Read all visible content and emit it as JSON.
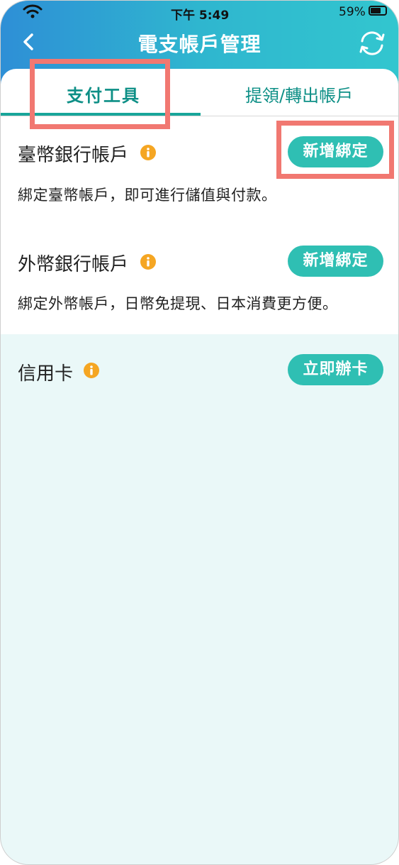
{
  "status_bar": {
    "time": "下午 5:49",
    "battery": "59%"
  },
  "header": {
    "title": "電支帳戶管理"
  },
  "tabs": [
    {
      "label": "支付工具",
      "active": true
    },
    {
      "label": "提領/轉出帳戶",
      "active": false
    }
  ],
  "sections": {
    "twd": {
      "title": "臺幣銀行帳戶",
      "button": "新增綁定",
      "description": "綁定臺幣帳戶，即可進行儲值與付款。"
    },
    "fx": {
      "title": "外幣銀行帳戶",
      "button": "新增綁定",
      "description": "綁定外幣帳戶，日幣免提現、日本消費更方便。"
    },
    "credit": {
      "title": "信用卡",
      "button": "立即辦卡"
    }
  },
  "colors": {
    "accent": "#2fbfb3",
    "info": "#f5a623",
    "highlight": "#f17871",
    "tab_text": "#0d8f86"
  },
  "icons": [
    "wifi-icon",
    "battery-icon",
    "back-chevron-icon",
    "refresh-icon",
    "info-icon"
  ]
}
